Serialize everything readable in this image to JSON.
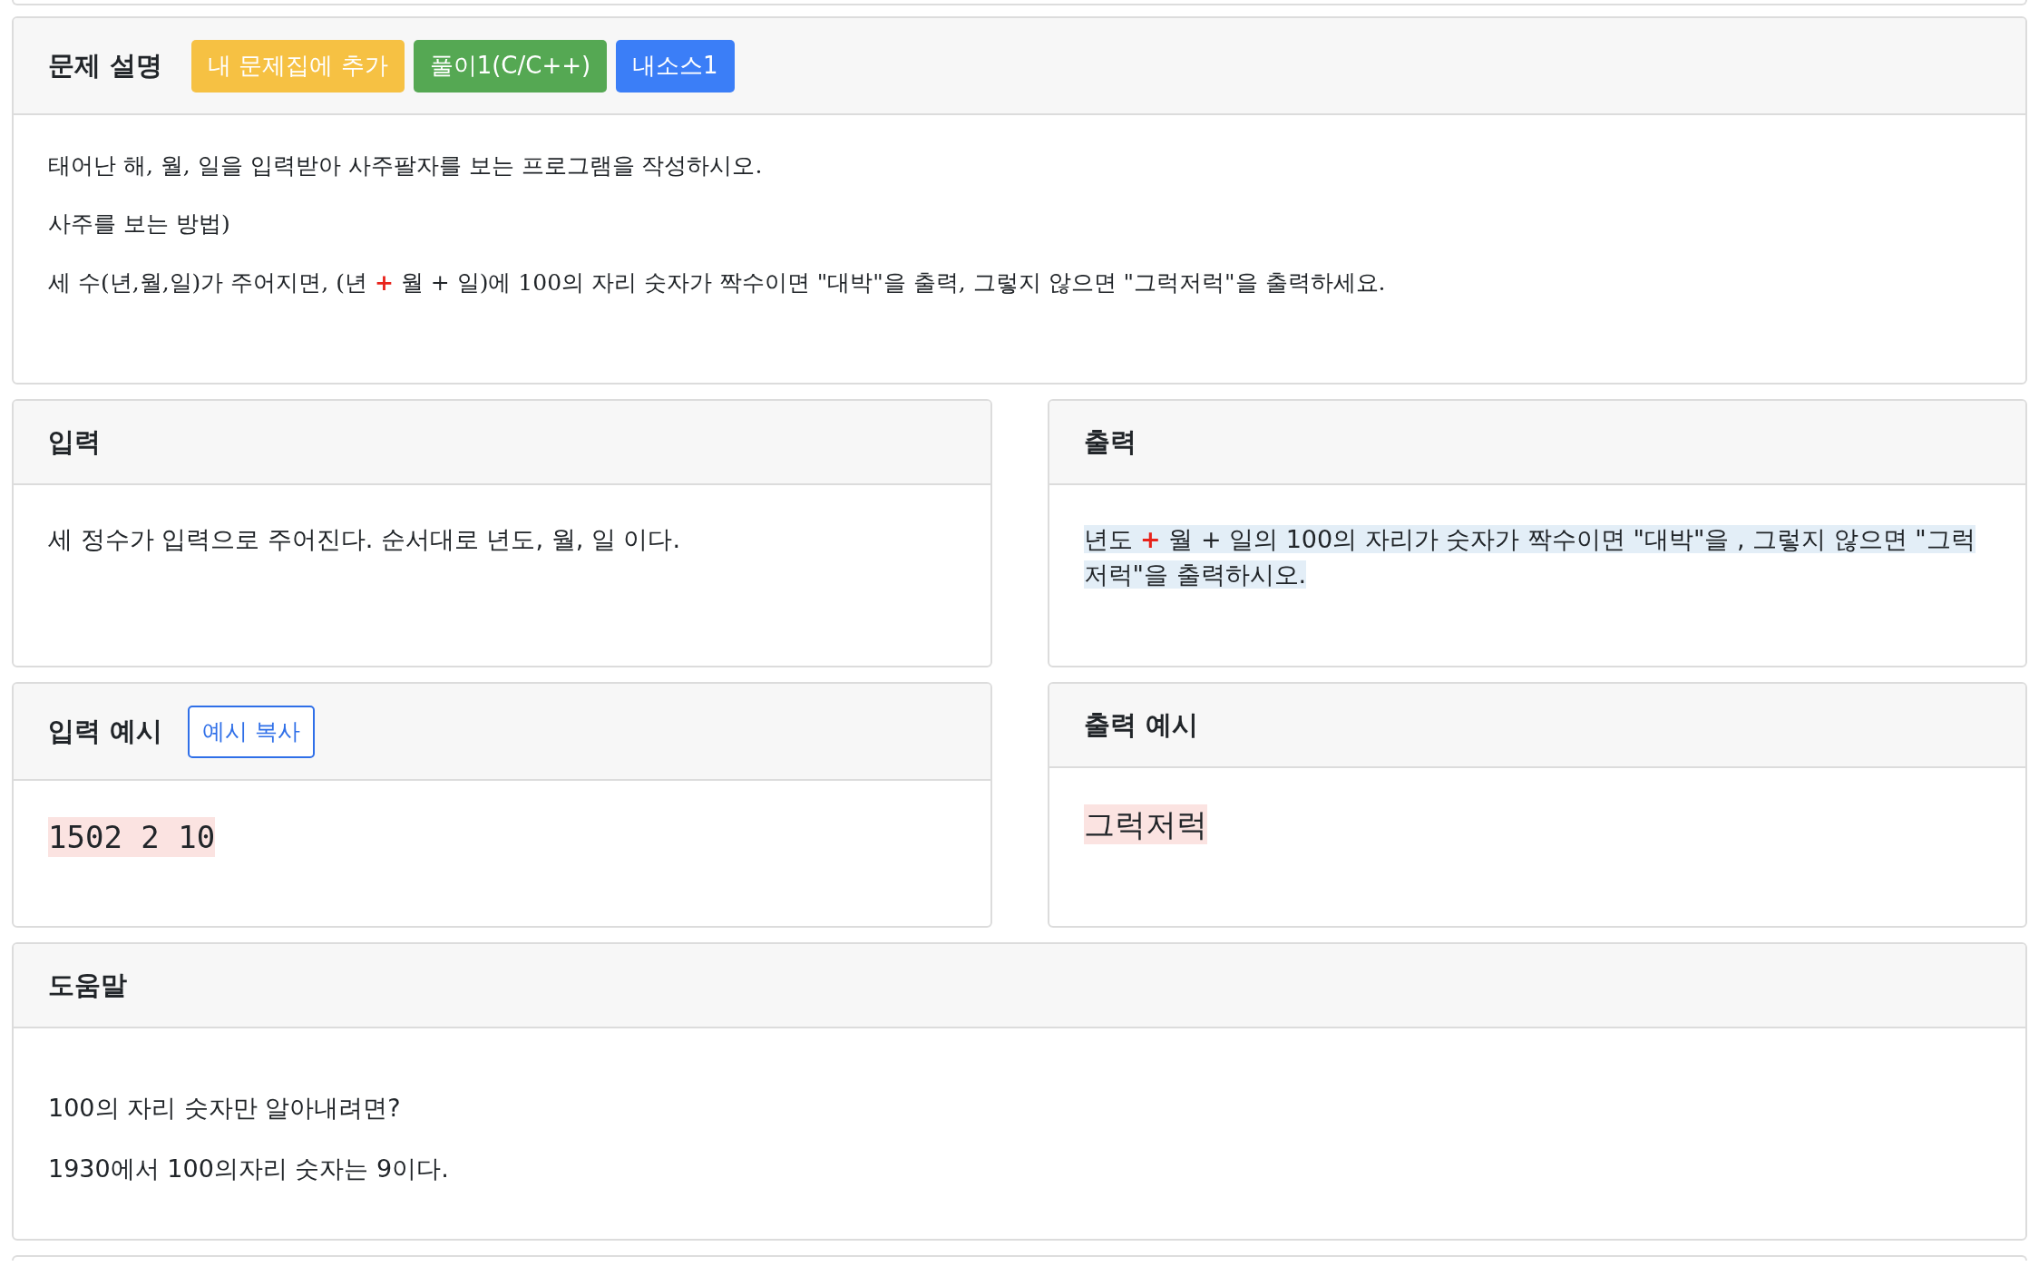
{
  "description": {
    "title": "문제 설명",
    "buttons": [
      {
        "label": "내 문제집에 추가",
        "kind": "warning"
      },
      {
        "label": "풀이1(C/C++)",
        "kind": "success"
      },
      {
        "label": "내소스1",
        "kind": "primary"
      }
    ],
    "paragraphs": [
      "태어난 해, 월, 일을 입력받아 사주팔자를 보는 프로그램을 작성하시오.",
      "사주를 보는 방법)",
      "세 수(년,월,일)가 주어지면,  (년 **+** 월 + 일)에 100의 자리 숫자가 짝수이면 \"대박\"을 출력, 그렇지 않으면 \"그럭저럭\"을 출력하세요."
    ]
  },
  "input": {
    "title": "입력",
    "text": "세 정수가 입력으로 주어진다. 순서대로 년도, 월, 일 이다.",
    "highlighted": false
  },
  "output": {
    "title": "출력",
    "text": "년도 **+** 월 + 일의 100의 자리가 숫자가 짝수이면 \"대박\"을 , 그렇지 않으면 \"그럭저럭\"을 출력하시오.",
    "highlighted": true
  },
  "sample_input": {
    "title": "입력 예시",
    "copy_button": "예시 복사",
    "text": "1502 2 10"
  },
  "sample_output": {
    "title": "출력 예시",
    "text": "그럭저럭"
  },
  "hint": {
    "title": "도움말",
    "paragraphs": [
      "100의 자리 숫자만 알아내려면?",
      "1930에서 100의자리 숫자는 9이다."
    ]
  }
}
